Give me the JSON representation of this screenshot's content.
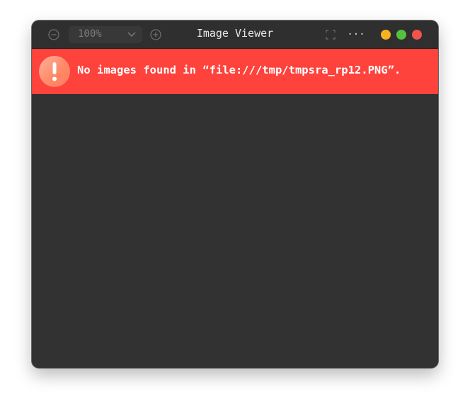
{
  "window": {
    "title": "Image Viewer"
  },
  "toolbar": {
    "zoom_value": "100%",
    "icons": {
      "zoom_out": "minus-circle-icon",
      "zoom_in": "plus-circle-icon",
      "zoom_dropdown": "chevron-down-icon",
      "fullscreen": "fullscreen-icon",
      "more": "more-horizontal-icon"
    },
    "more_label": "···"
  },
  "traffic_lights": {
    "minimize_color": "#f6b223",
    "maximize_color": "#55c13e",
    "close_color": "#f2534c"
  },
  "banner": {
    "message": "No images found in “file:///tmp/tmpsra_rp12.PNG”.",
    "icon": "alert-icon",
    "background": "#fe423c"
  }
}
